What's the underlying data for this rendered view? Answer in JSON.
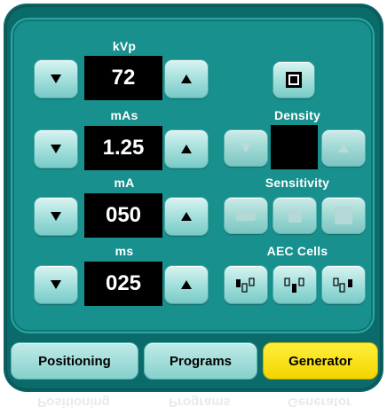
{
  "controls": {
    "kvp": {
      "label": "kVp",
      "value": "72"
    },
    "mas": {
      "label": "mAs",
      "value": "1.25"
    },
    "ma": {
      "label": "mA",
      "value": "050"
    },
    "ms": {
      "label": "ms",
      "value": "025"
    }
  },
  "density": {
    "label": "Density"
  },
  "sensitivity": {
    "label": "Sensitivity"
  },
  "aec": {
    "label": "AEC Cells"
  },
  "tabs": [
    {
      "label": "Positioning",
      "active": false
    },
    {
      "label": "Programs",
      "active": false
    },
    {
      "label": "Generator",
      "active": true
    }
  ],
  "colors": {
    "panel": "#17908e",
    "frame": "#0b6a6a",
    "active_tab": "#f7dc12",
    "display": "#000000"
  },
  "icons": {
    "down": "triangle-down",
    "up": "triangle-up",
    "aec_toggle": "square-frame",
    "sensitivity": "rectangle-steps",
    "aec_cell": "cell-markers"
  }
}
